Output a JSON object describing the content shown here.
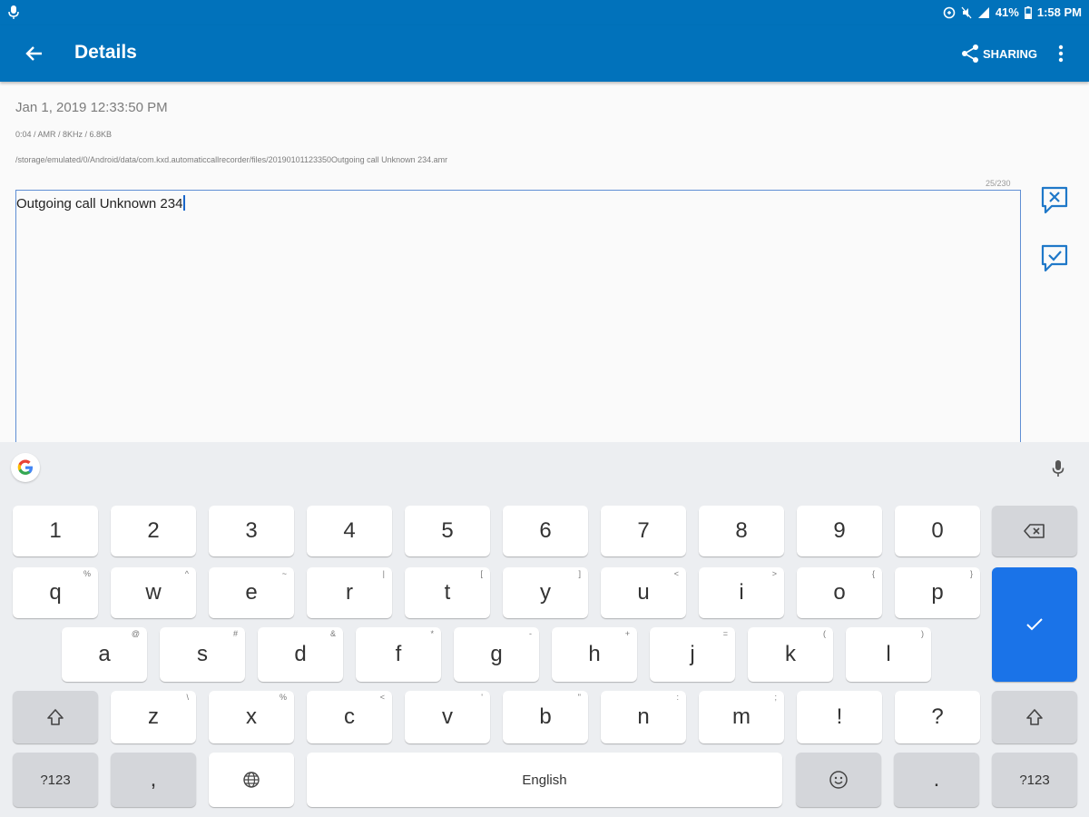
{
  "status_bar": {
    "battery": "41%",
    "time": "1:58 PM"
  },
  "app_bar": {
    "title": "Details",
    "sharing_label": "SHARING"
  },
  "recording": {
    "date": "Jan 1, 2019 12:33:50 PM",
    "meta": "0:04 / AMR / 8KHz / 6.8KB",
    "path": "/storage/emulated/0/Android/data/com.kxd.automaticcallrecorder/files/20190101123350Outgoing call Unknown 234.amr",
    "char_counter": "25/230",
    "note_value": "Outgoing call Unknown 234"
  },
  "colors": {
    "primary": "#0172bb",
    "accent": "#1a73e8"
  },
  "keyboard": {
    "number_row": [
      "1",
      "2",
      "3",
      "4",
      "5",
      "6",
      "7",
      "8",
      "9",
      "0"
    ],
    "row1": [
      "q",
      "w",
      "e",
      "r",
      "t",
      "y",
      "u",
      "i",
      "o",
      "p"
    ],
    "row1_hints": [
      "%",
      "^",
      "~",
      "|",
      "[",
      "]",
      "<",
      ">",
      "{",
      "}"
    ],
    "row2": [
      "a",
      "s",
      "d",
      "f",
      "g",
      "h",
      "j",
      "k",
      "l"
    ],
    "row2_hints": [
      "@",
      "#",
      "&",
      "*",
      "-",
      "+",
      "=",
      "(",
      ")"
    ],
    "row3": [
      "z",
      "x",
      "c",
      "v",
      "b",
      "n",
      "m",
      "!",
      "?"
    ],
    "row3_hints": [
      "\\",
      "%",
      "<",
      "'",
      "\"",
      ":",
      ";",
      "",
      ""
    ],
    "symbols_label": "?123",
    "comma": ",",
    "space_label": "English",
    "period": "."
  }
}
